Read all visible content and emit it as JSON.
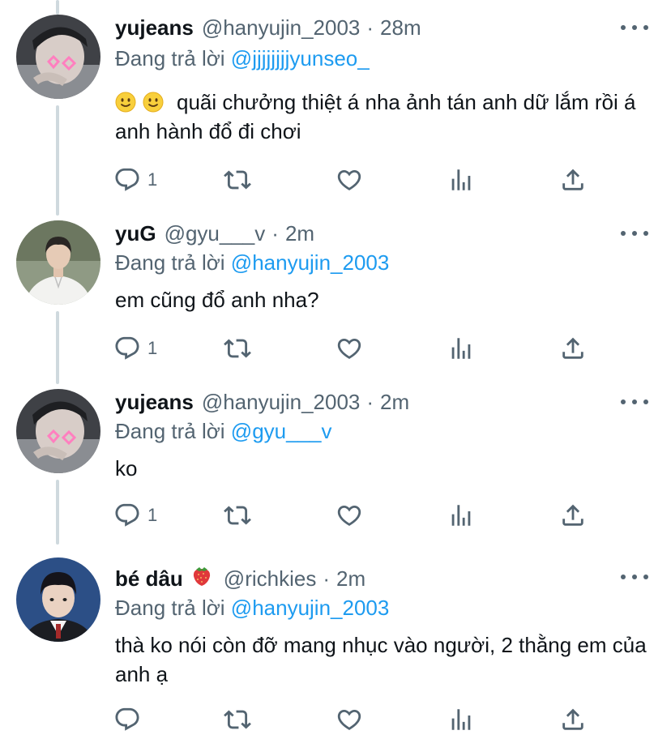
{
  "tweets": [
    {
      "name": "yujeans",
      "handle": "@hanyujin_2003",
      "dot": "·",
      "time": "28m",
      "reply_prefix": "Đang trả lời",
      "reply_to": "@jjjjjjjjyunseo_",
      "text": "quãi chưởng thiệt á nha ảnh tán anh dữ lắm rồi á anh hành đổ đi chơi",
      "text_emojis": [
        "slightly-smiling-face",
        "slightly-smiling-face"
      ],
      "reply_count": "1"
    },
    {
      "name": "yuG",
      "handle": "@gyu___v",
      "dot": "·",
      "time": "2m",
      "reply_prefix": "Đang trả lời",
      "reply_to": "@hanyujin_2003",
      "text": "em cũng đổ anh nha?",
      "reply_count": "1"
    },
    {
      "name": "yujeans",
      "handle": "@hanyujin_2003",
      "dot": "·",
      "time": "2m",
      "reply_prefix": "Đang trả lời",
      "reply_to": "@gyu___v",
      "text": "ko",
      "reply_count": "1"
    },
    {
      "name": "bé dâu",
      "name_emoji": "strawberry",
      "handle": "@richkies",
      "dot": "·",
      "time": "2m",
      "reply_prefix": "Đang trả lời",
      "reply_to": "@hanyujin_2003",
      "text": "thà ko nói còn đỡ mang nhục vào người, 2 thằng em của anh ạ",
      "reply_count": ""
    }
  ],
  "icons": [
    "reply-icon",
    "retweet-icon",
    "like-icon",
    "analytics-icon",
    "share-icon",
    "more-icon"
  ],
  "colors": {
    "text": "#0f1419",
    "secondary": "#536471",
    "link": "#1d9bf0",
    "thread_line": "#cfd9de"
  }
}
